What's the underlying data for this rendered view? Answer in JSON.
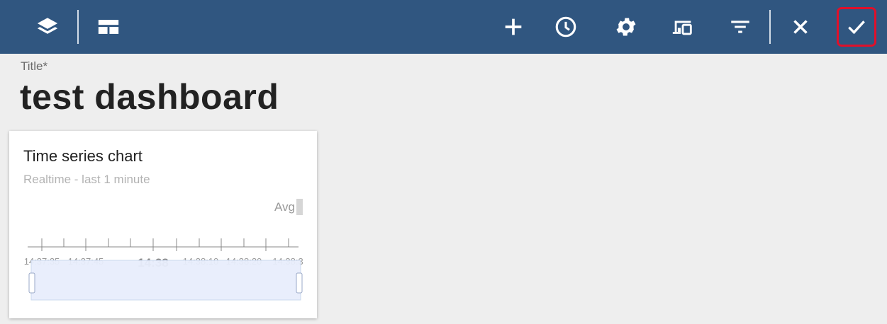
{
  "toolbar": {
    "left_icons": [
      "layers-icon",
      "dashboard-layout-icon"
    ],
    "right_icons": [
      "add-icon",
      "clock-icon",
      "gear-icon",
      "devices-icon",
      "filter-icon",
      "close-icon",
      "check-icon"
    ],
    "accent_color": "#305680",
    "highlight_color": "#e0102a"
  },
  "header": {
    "title_label": "Title*",
    "title_value": "test dashboard"
  },
  "widget": {
    "title": "Time series chart",
    "subtitle": "Realtime - last 1 minute",
    "legend_label": "Avg",
    "axis_ticks": [
      "14:37:35",
      "14:37:45",
      "14:38",
      "14:38:10",
      "14:38:20",
      "14:38:3"
    ],
    "selector_fill": "#e8eefc"
  }
}
